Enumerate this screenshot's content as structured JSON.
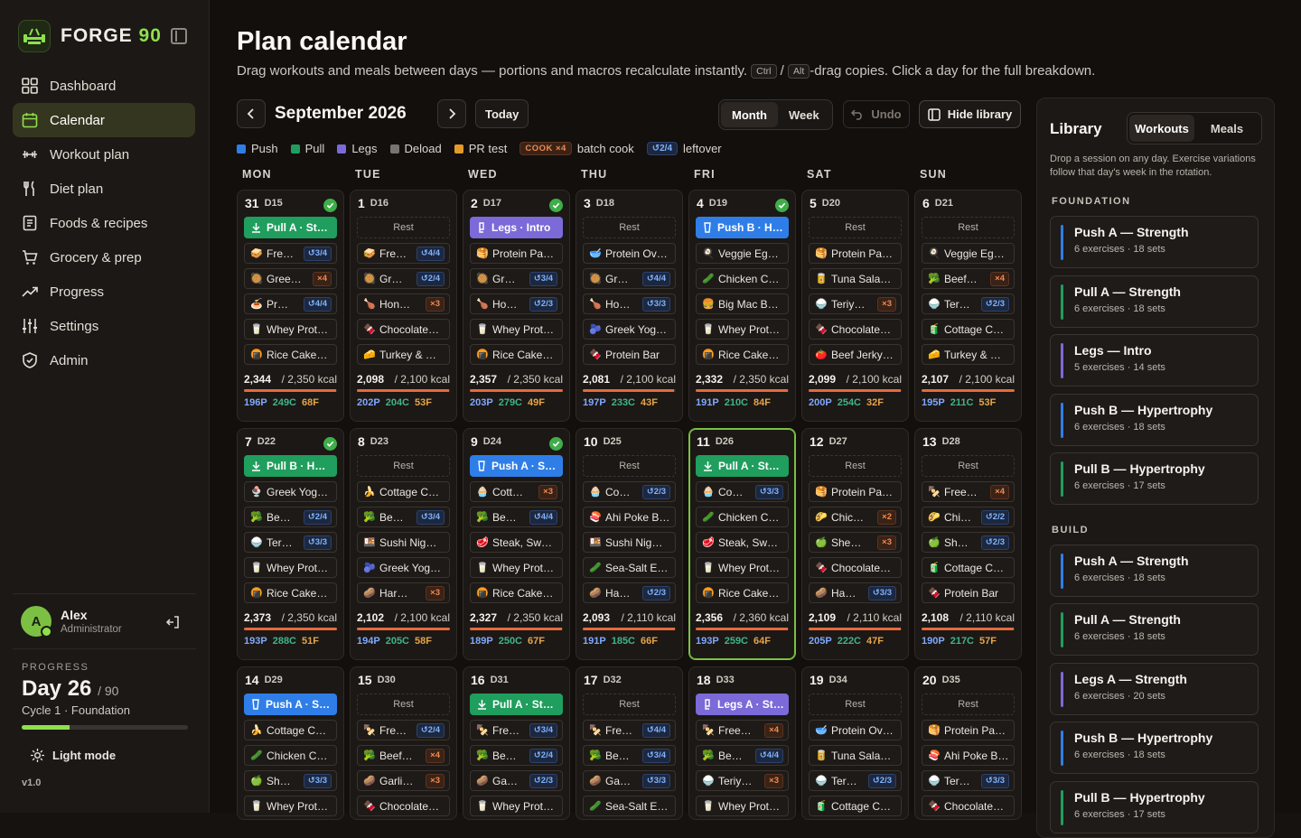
{
  "brand": {
    "name": "FORGE",
    "num": "90"
  },
  "nav": [
    {
      "label": "Dashboard",
      "icon": "grid-icon"
    },
    {
      "label": "Calendar",
      "icon": "calendar-icon",
      "active": true
    },
    {
      "label": "Workout plan",
      "icon": "dumbbell-icon"
    },
    {
      "label": "Diet plan",
      "icon": "fork-knife-icon"
    },
    {
      "label": "Foods & recipes",
      "icon": "book-icon"
    },
    {
      "label": "Grocery & prep",
      "icon": "cart-icon"
    },
    {
      "label": "Progress",
      "icon": "trend-icon"
    },
    {
      "label": "Settings",
      "icon": "sliders-icon"
    },
    {
      "label": "Admin",
      "icon": "shield-icon"
    }
  ],
  "user": {
    "initial": "A",
    "name": "Alex",
    "role": "Administrator"
  },
  "progress": {
    "label": "PROGRESS",
    "day": "Day 26",
    "total": "/ 90",
    "cycle": "Cycle 1 · Foundation",
    "fraction": 0.289
  },
  "light_mode": "Light mode",
  "version": "v1.0",
  "page": {
    "title": "Plan calendar",
    "sub_a": "Drag workouts and meals between days — portions and macros recalculate instantly. ",
    "kbd1": "Ctrl",
    "slash": " / ",
    "kbd2": "Alt",
    "sub_b": "-drag copies. Click a day for the full breakdown."
  },
  "toolbar": {
    "month": "September 2026",
    "today": "Today",
    "view_month": "Month",
    "view_week": "Week",
    "undo": "Undo",
    "hide_library": "Hide library"
  },
  "legend": {
    "push": "Push",
    "pull": "Pull",
    "legs": "Legs",
    "deload": "Deload",
    "pr": "PR test",
    "cook_badge": "COOK ×4",
    "cook": "batch cook",
    "left_badge": "↺2/4",
    "left": "leftover"
  },
  "colors": {
    "push": "#2f7ee8",
    "pull": "#1f9e5d",
    "legs": "#7b6ad8",
    "deload": "#7a7470",
    "pr": "#e39a2b",
    "accent": "#8ee04c"
  },
  "weekdays": [
    "MON",
    "TUE",
    "WED",
    "THU",
    "FRI",
    "SAT",
    "SUN"
  ],
  "days": [
    {
      "n": "31",
      "c": "D15",
      "done": true,
      "w": {
        "t": "pull",
        "l": "Pull A · St…"
      },
      "meals": [
        [
          "🥪",
          "Fre…",
          "left",
          "↺3/4"
        ],
        [
          "🥘",
          "Gree…",
          "cook",
          "×4"
        ],
        [
          "🍝",
          "Pr…",
          "left",
          "↺4/4"
        ],
        [
          "🥛",
          "Whey Prot…"
        ],
        [
          "🍘",
          "Rice Cake…"
        ]
      ],
      "k": "2,344",
      "kt": "/ 2,350 kcal",
      "f": 0.99,
      "p": "196P",
      "cb": "249C",
      "fa": "68F"
    },
    {
      "n": "1",
      "c": "D16",
      "meals": [
        [
          "🥪",
          "Fre…",
          "left",
          "↺4/4"
        ],
        [
          "🥘",
          "Gr…",
          "left",
          "↺2/4"
        ],
        [
          "🍗",
          "Hon…",
          "cook",
          "×3"
        ],
        [
          "🍫",
          "Chocolate…"
        ],
        [
          "🧀",
          "Turkey & …"
        ]
      ],
      "k": "2,098",
      "kt": "/ 2,100 kcal",
      "f": 0.99,
      "p": "202P",
      "cb": "204C",
      "fa": "53F"
    },
    {
      "n": "2",
      "c": "D17",
      "done": true,
      "w": {
        "t": "legs",
        "l": "Legs · Intro"
      },
      "meals": [
        [
          "🥞",
          "Protein Pa…"
        ],
        [
          "🥘",
          "Gr…",
          "left",
          "↺3/4"
        ],
        [
          "🍗",
          "Ho…",
          "left",
          "↺2/3"
        ],
        [
          "🥛",
          "Whey Prot…"
        ],
        [
          "🍘",
          "Rice Cake…"
        ]
      ],
      "k": "2,357",
      "kt": "/ 2,350 kcal",
      "f": 1,
      "p": "203P",
      "cb": "279C",
      "fa": "49F"
    },
    {
      "n": "3",
      "c": "D18",
      "meals": [
        [
          "🥣",
          "Protein Ov…"
        ],
        [
          "🥘",
          "Gr…",
          "left",
          "↺4/4"
        ],
        [
          "🍗",
          "Ho…",
          "left",
          "↺3/3"
        ],
        [
          "🫐",
          "Greek Yog…"
        ],
        [
          "🍫",
          "Protein Bar"
        ]
      ],
      "k": "2,081",
      "kt": "/ 2,100 kcal",
      "f": 0.98,
      "p": "197P",
      "cb": "233C",
      "fa": "43F"
    },
    {
      "n": "4",
      "c": "D19",
      "done": true,
      "w": {
        "t": "push",
        "l": "Push B · H…"
      },
      "meals": [
        [
          "🍳",
          "Veggie Eg…"
        ],
        [
          "🥒",
          "Chicken C…"
        ],
        [
          "🍔",
          "Big Mac B…"
        ],
        [
          "🥛",
          "Whey Prot…"
        ],
        [
          "🍘",
          "Rice Cake…"
        ]
      ],
      "k": "2,332",
      "kt": "/ 2,350 kcal",
      "f": 0.99,
      "p": "191P",
      "cb": "210C",
      "fa": "84F"
    },
    {
      "n": "5",
      "c": "D20",
      "meals": [
        [
          "🥞",
          "Protein Pa…"
        ],
        [
          "🥫",
          "Tuna Sala…"
        ],
        [
          "🍚",
          "Teriy…",
          "cook",
          "×3"
        ],
        [
          "🍫",
          "Chocolate…"
        ],
        [
          "🍅",
          "Beef Jerky…"
        ]
      ],
      "k": "2,099",
      "kt": "/ 2,100 kcal",
      "f": 0.99,
      "p": "200P",
      "cb": "254C",
      "fa": "32F"
    },
    {
      "n": "6",
      "c": "D21",
      "meals": [
        [
          "🍳",
          "Veggie Eg…"
        ],
        [
          "🥦",
          "Beef…",
          "cook",
          "×4"
        ],
        [
          "🍚",
          "Ter…",
          "left",
          "↺2/3"
        ],
        [
          "🧃",
          "Cottage C…"
        ],
        [
          "🧀",
          "Turkey & …"
        ]
      ],
      "k": "2,107",
      "kt": "/ 2,100 kcal",
      "f": 1,
      "p": "195P",
      "cb": "211C",
      "fa": "53F"
    },
    {
      "n": "7",
      "c": "D22",
      "done": true,
      "w": {
        "t": "pull",
        "l": "Pull B · H…"
      },
      "meals": [
        [
          "🍨",
          "Greek Yog…"
        ],
        [
          "🥦",
          "Be…",
          "left",
          "↺2/4"
        ],
        [
          "🍚",
          "Ter…",
          "left",
          "↺3/3"
        ],
        [
          "🥛",
          "Whey Prot…"
        ],
        [
          "🍘",
          "Rice Cake…"
        ]
      ],
      "k": "2,373",
      "kt": "/ 2,350 kcal",
      "f": 1,
      "p": "193P",
      "cb": "288C",
      "fa": "51F"
    },
    {
      "n": "8",
      "c": "D23",
      "meals": [
        [
          "🍌",
          "Cottage C…"
        ],
        [
          "🥦",
          "Be…",
          "left",
          "↺3/4"
        ],
        [
          "🍱",
          "Sushi Nig…"
        ],
        [
          "🫐",
          "Greek Yog…"
        ],
        [
          "🥔",
          "Har…",
          "cook",
          "×3"
        ]
      ],
      "k": "2,102",
      "kt": "/ 2,100 kcal",
      "f": 1,
      "p": "194P",
      "cb": "205C",
      "fa": "58F"
    },
    {
      "n": "9",
      "c": "D24",
      "done": true,
      "w": {
        "t": "push",
        "l": "Push A · S…"
      },
      "meals": [
        [
          "🧁",
          "Cott…",
          "cook",
          "×3"
        ],
        [
          "🥦",
          "Be…",
          "left",
          "↺4/4"
        ],
        [
          "🥩",
          "Steak, Sw…"
        ],
        [
          "🥛",
          "Whey Prot…"
        ],
        [
          "🍘",
          "Rice Cake…"
        ]
      ],
      "k": "2,327",
      "kt": "/ 2,350 kcal",
      "f": 0.99,
      "p": "189P",
      "cb": "250C",
      "fa": "67F"
    },
    {
      "n": "10",
      "c": "D25",
      "meals": [
        [
          "🧁",
          "Co…",
          "left",
          "↺2/3"
        ],
        [
          "🍣",
          "Ahi Poke B…"
        ],
        [
          "🍱",
          "Sushi Nig…"
        ],
        [
          "🥒",
          "Sea-Salt E…"
        ],
        [
          "🥔",
          "Ha…",
          "left",
          "↺2/3"
        ]
      ],
      "k": "2,093",
      "kt": "/ 2,110 kcal",
      "f": 0.99,
      "p": "191P",
      "cb": "185C",
      "fa": "66F"
    },
    {
      "n": "11",
      "c": "D26",
      "today": true,
      "w": {
        "t": "pull",
        "l": "Pull A · St…"
      },
      "meals": [
        [
          "🧁",
          "Co…",
          "left",
          "↺3/3"
        ],
        [
          "🥒",
          "Chicken C…"
        ],
        [
          "🥩",
          "Steak, Sw…"
        ],
        [
          "🥛",
          "Whey Prot…"
        ],
        [
          "🍘",
          "Rice Cake…"
        ]
      ],
      "k": "2,356",
      "kt": "/ 2,360 kcal",
      "f": 0.99,
      "p": "193P",
      "cb": "259C",
      "fa": "64F"
    },
    {
      "n": "12",
      "c": "D27",
      "meals": [
        [
          "🥞",
          "Protein Pa…"
        ],
        [
          "🌮",
          "Chic…",
          "cook",
          "×2"
        ],
        [
          "🍏",
          "She…",
          "cook",
          "×3"
        ],
        [
          "🍫",
          "Chocolate…"
        ],
        [
          "🥔",
          "Ha…",
          "left",
          "↺3/3"
        ]
      ],
      "k": "2,109",
      "kt": "/ 2,110 kcal",
      "f": 0.99,
      "p": "205P",
      "cb": "222C",
      "fa": "47F"
    },
    {
      "n": "13",
      "c": "D28",
      "meals": [
        [
          "🍢",
          "Free…",
          "cook",
          "×4"
        ],
        [
          "🌮",
          "Chi…",
          "left",
          "↺2/2"
        ],
        [
          "🍏",
          "Sh…",
          "left",
          "↺2/3"
        ],
        [
          "🧃",
          "Cottage C…"
        ],
        [
          "🍫",
          "Protein Bar"
        ]
      ],
      "k": "2,108",
      "kt": "/ 2,110 kcal",
      "f": 0.99,
      "p": "190P",
      "cb": "217C",
      "fa": "57F"
    },
    {
      "n": "14",
      "c": "D29",
      "w": {
        "t": "push",
        "l": "Push A · S…"
      },
      "meals": [
        [
          "🍌",
          "Cottage C…"
        ],
        [
          "🥒",
          "Chicken C…"
        ],
        [
          "🍏",
          "Sh…",
          "left",
          "↺3/3"
        ],
        [
          "🥛",
          "Whey Prot…"
        ]
      ]
    },
    {
      "n": "15",
      "c": "D30",
      "meals": [
        [
          "🍢",
          "Fre…",
          "left",
          "↺2/4"
        ],
        [
          "🥦",
          "Beef…",
          "cook",
          "×4"
        ],
        [
          "🥔",
          "Garli…",
          "cook",
          "×3"
        ],
        [
          "🍫",
          "Chocolate…"
        ]
      ]
    },
    {
      "n": "16",
      "c": "D31",
      "w": {
        "t": "pull",
        "l": "Pull A · St…"
      },
      "meals": [
        [
          "🍢",
          "Fre…",
          "left",
          "↺3/4"
        ],
        [
          "🥦",
          "Be…",
          "left",
          "↺2/4"
        ],
        [
          "🥔",
          "Ga…",
          "left",
          "↺2/3"
        ],
        [
          "🥛",
          "Whey Prot…"
        ]
      ]
    },
    {
      "n": "17",
      "c": "D32",
      "meals": [
        [
          "🍢",
          "Fre…",
          "left",
          "↺4/4"
        ],
        [
          "🥦",
          "Be…",
          "left",
          "↺3/4"
        ],
        [
          "🥔",
          "Ga…",
          "left",
          "↺3/3"
        ],
        [
          "🥒",
          "Sea-Salt E…"
        ]
      ]
    },
    {
      "n": "18",
      "c": "D33",
      "w": {
        "t": "legs",
        "l": "Legs A · St…"
      },
      "meals": [
        [
          "🍢",
          "Free…",
          "cook",
          "×4"
        ],
        [
          "🥦",
          "Be…",
          "left",
          "↺4/4"
        ],
        [
          "🍚",
          "Teriy…",
          "cook",
          "×3"
        ],
        [
          "🥛",
          "Whey Prot…"
        ]
      ]
    },
    {
      "n": "19",
      "c": "D34",
      "meals": [
        [
          "🥣",
          "Protein Ov…"
        ],
        [
          "🥫",
          "Tuna Sala…"
        ],
        [
          "🍚",
          "Ter…",
          "left",
          "↺2/3"
        ],
        [
          "🧃",
          "Cottage C…"
        ]
      ]
    },
    {
      "n": "20",
      "c": "D35",
      "meals": [
        [
          "🥞",
          "Protein Pa…"
        ],
        [
          "🍣",
          "Ahi Poke B…"
        ],
        [
          "🍚",
          "Ter…",
          "left",
          "↺3/3"
        ],
        [
          "🍫",
          "Chocolate…"
        ]
      ]
    }
  ],
  "rest_label": "Rest",
  "library": {
    "title": "Library",
    "tab_workouts": "Workouts",
    "tab_meals": "Meals",
    "hint": "Drop a session on any day. Exercise variations follow that day's week in the rotation.",
    "groups": [
      {
        "name": "FOUNDATION",
        "items": [
          {
            "name": "Push A — Strength",
            "meta": "6 exercises · 18 sets",
            "t": "push"
          },
          {
            "name": "Pull A — Strength",
            "meta": "6 exercises · 18 sets",
            "t": "pull"
          },
          {
            "name": "Legs — Intro",
            "meta": "5 exercises · 14 sets",
            "t": "legs"
          },
          {
            "name": "Push B — Hypertrophy",
            "meta": "6 exercises · 18 sets",
            "t": "push"
          },
          {
            "name": "Pull B — Hypertrophy",
            "meta": "6 exercises · 17 sets",
            "t": "pull"
          }
        ]
      },
      {
        "name": "BUILD",
        "items": [
          {
            "name": "Push A — Strength",
            "meta": "6 exercises · 18 sets",
            "t": "push"
          },
          {
            "name": "Pull A — Strength",
            "meta": "6 exercises · 18 sets",
            "t": "pull"
          },
          {
            "name": "Legs A — Strength",
            "meta": "6 exercises · 20 sets",
            "t": "legs"
          },
          {
            "name": "Push B — Hypertrophy",
            "meta": "6 exercises · 18 sets",
            "t": "push"
          },
          {
            "name": "Pull B — Hypertrophy",
            "meta": "6 exercises · 17 sets",
            "t": "pull"
          }
        ]
      }
    ]
  }
}
